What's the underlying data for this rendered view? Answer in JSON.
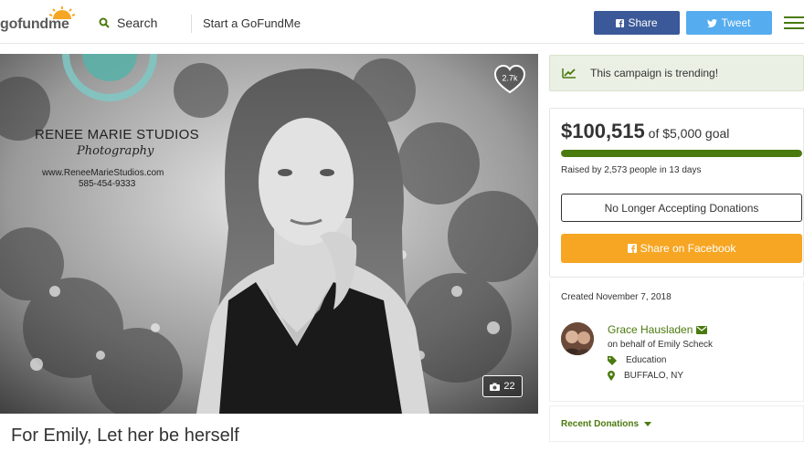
{
  "header": {
    "logo": {
      "part1": "go",
      "part2": "fund",
      "part3": "me"
    },
    "search_label": "Search",
    "start_label": "Start a GoFundMe",
    "share_label": "Share",
    "tweet_label": "Tweet"
  },
  "hero": {
    "heart_count": "2.7k",
    "photo_count": "22",
    "watermark": {
      "studio": "RENEE MARIE STUDIOS",
      "subtitle": "Photography",
      "website": "www.ReneeMarieStudios.com",
      "phone": "585-454-9333"
    }
  },
  "campaign": {
    "title": "For Emily, Let her be herself"
  },
  "trending": {
    "text": "This campaign is trending!"
  },
  "donation": {
    "amount": "$100,515",
    "goal_text": "of $5,000 goal",
    "progress": 1.0,
    "raised_by": "Raised by 2,573 people in 13 days",
    "no_longer_label": "No Longer Accepting Donations",
    "fb_share_label": "Share on Facebook"
  },
  "organizer": {
    "created": "Created November 7, 2018",
    "name": "Grace Hausladen",
    "behalf": "on behalf of Emily Scheck",
    "category": "Education",
    "location": "BUFFALO, NY"
  },
  "recent": {
    "label": "Recent Donations"
  },
  "colors": {
    "brand_green": "#4b7a0e",
    "facebook_blue": "#3b5998",
    "twitter_blue": "#55acee",
    "orange": "#f6a623",
    "trending_bg": "#eaf0e4"
  }
}
